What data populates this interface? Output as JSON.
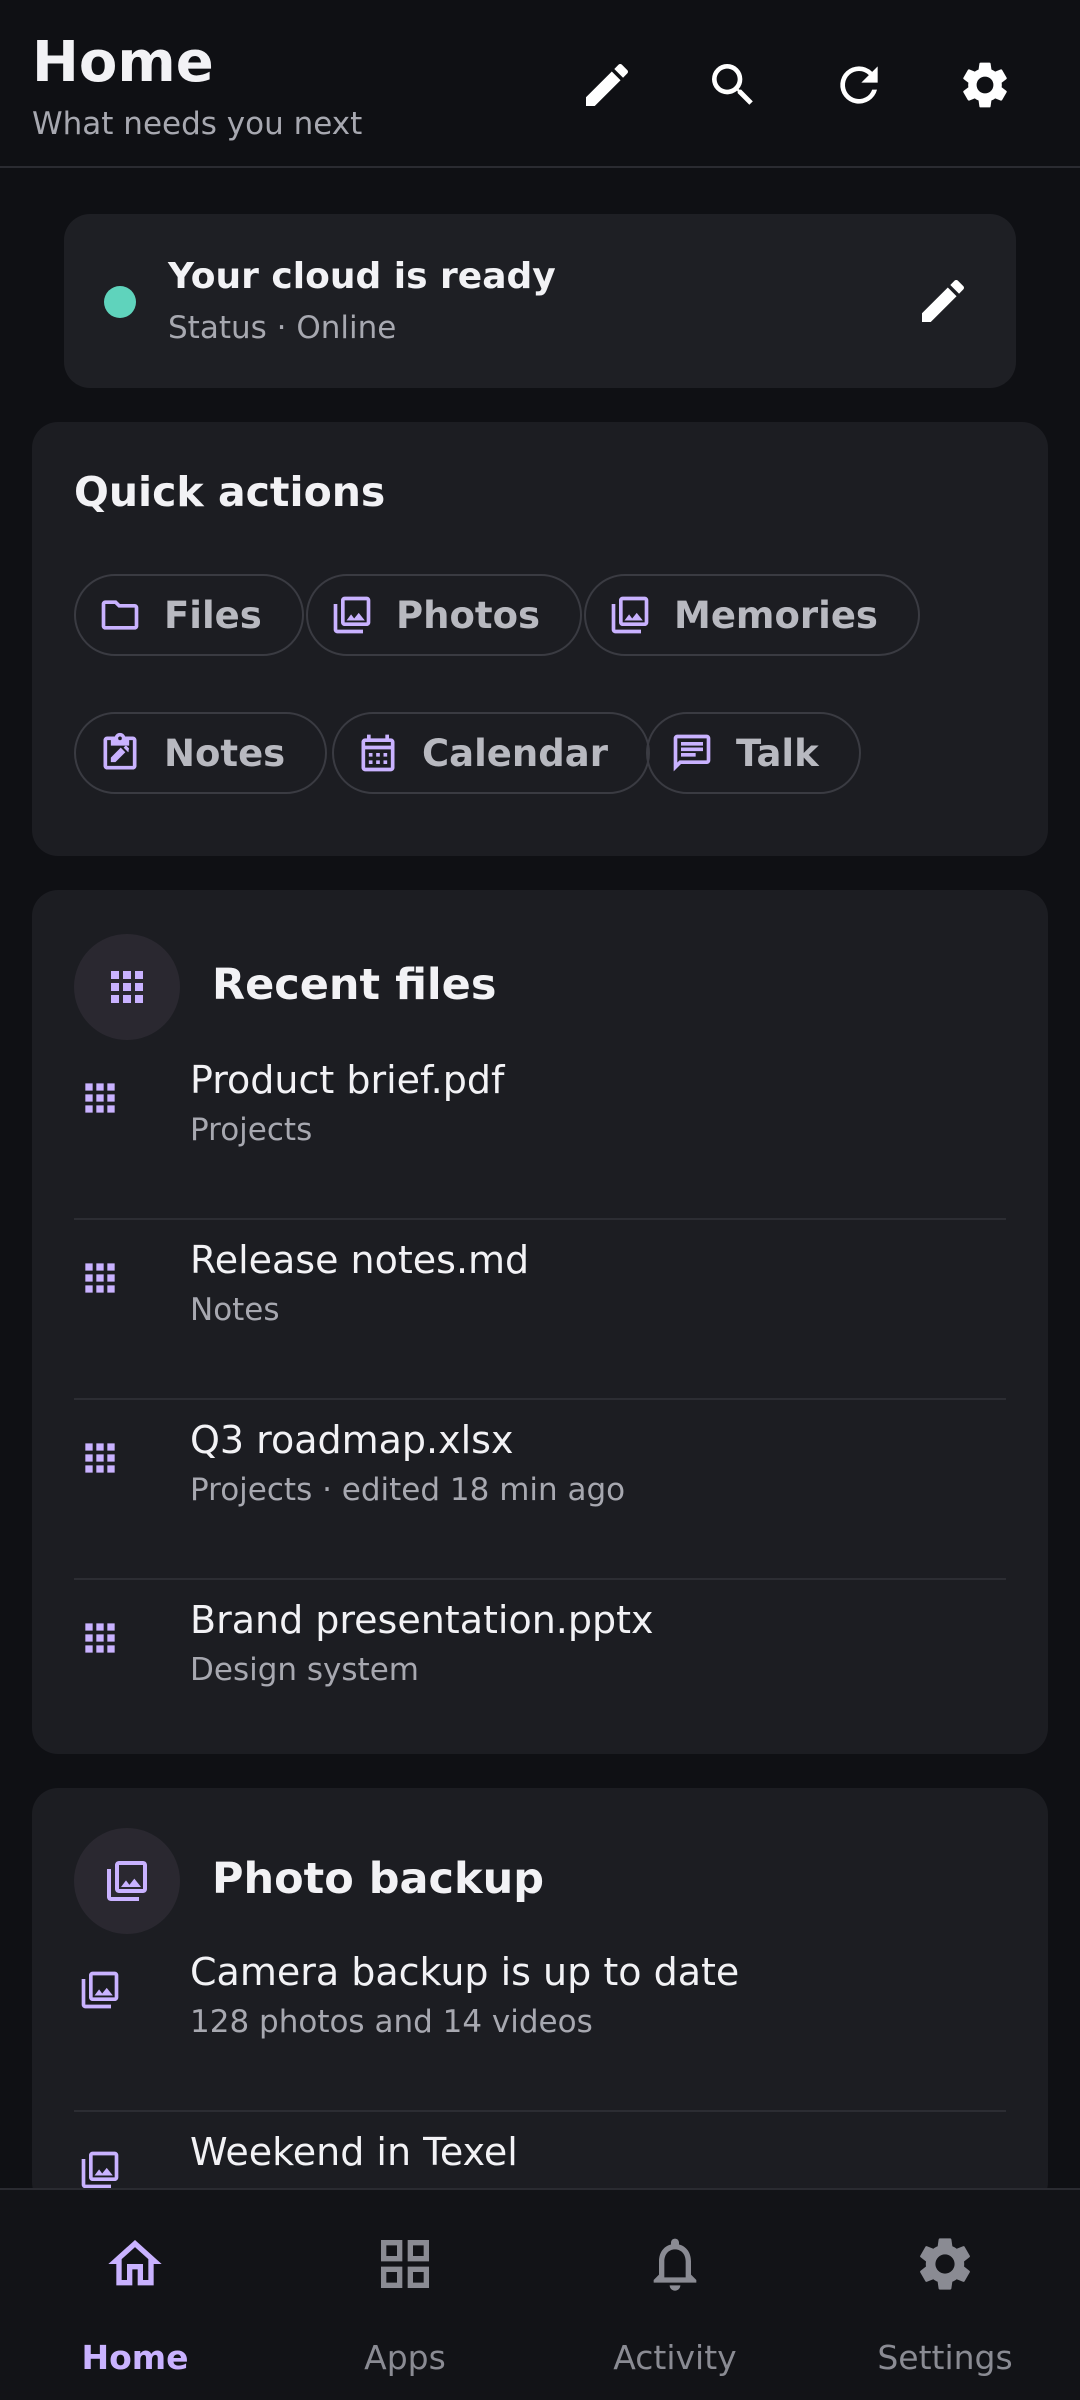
{
  "header": {
    "title": "Home",
    "subtitle": "What needs you next"
  },
  "status": {
    "title": "Your cloud is ready",
    "subtitle": "Status · Online",
    "dot_color": "#5fd3bc"
  },
  "quick_actions": {
    "title": "Quick actions",
    "chips": [
      {
        "label": "Files",
        "icon": "folder-icon"
      },
      {
        "label": "Photos",
        "icon": "photos-icon"
      },
      {
        "label": "Memories",
        "icon": "photos-icon"
      },
      {
        "label": "Notes",
        "icon": "clipboard-edit-icon"
      },
      {
        "label": "Calendar",
        "icon": "calendar-icon"
      },
      {
        "label": "Talk",
        "icon": "chat-icon"
      }
    ]
  },
  "recent_files": {
    "title": "Recent files",
    "items": [
      {
        "name": "Product brief.pdf",
        "meta": "Projects"
      },
      {
        "name": "Release notes.md",
        "meta": "Notes"
      },
      {
        "name": "Q3 roadmap.xlsx",
        "meta": "Projects · edited 18 min ago"
      },
      {
        "name": "Brand presentation.pptx",
        "meta": "Design system"
      }
    ]
  },
  "photo_backup": {
    "title": "Photo backup",
    "items": [
      {
        "name": "Camera backup is up to date",
        "meta": "128 photos and 14 videos"
      },
      {
        "name": "Weekend in Texel",
        "meta": ""
      }
    ]
  },
  "nav": {
    "items": [
      {
        "label": "Home",
        "icon": "home-icon"
      },
      {
        "label": "Apps",
        "icon": "apps-grid-icon"
      },
      {
        "label": "Activity",
        "icon": "bell-icon"
      },
      {
        "label": "Settings",
        "icon": "gear-icon"
      }
    ],
    "active": "Home"
  },
  "colors": {
    "accent": "#c9b2ff",
    "background": "#0f1014",
    "card": "#1c1d22"
  }
}
